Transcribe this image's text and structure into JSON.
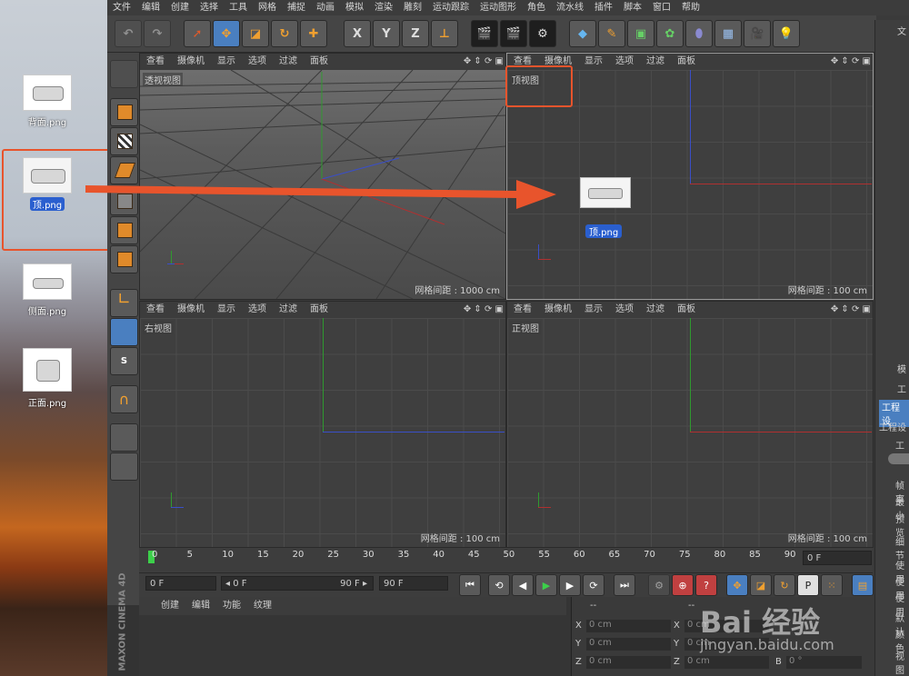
{
  "desktop": {
    "icons": [
      {
        "label": "背面.png",
        "selected": false
      },
      {
        "label": "顶.png",
        "selected": true
      },
      {
        "label": "侧面.png",
        "selected": false
      },
      {
        "label": "正面.png",
        "selected": false
      }
    ]
  },
  "menubar": [
    "文件",
    "编辑",
    "创建",
    "选择",
    "工具",
    "网格",
    "捕捉",
    "动画",
    "模拟",
    "渲染",
    "雕刻",
    "运动跟踪",
    "运动图形",
    "角色",
    "流水线",
    "插件",
    "脚本",
    "窗口",
    "帮助"
  ],
  "toolbar": {
    "axes": [
      "X",
      "Y",
      "Z"
    ]
  },
  "viewport_menu": [
    "查看",
    "摄像机",
    "显示",
    "选项",
    "过滤",
    "面板"
  ],
  "viewports": {
    "persp": {
      "name": "透视视图",
      "grid": "网格间距 : 1000 cm"
    },
    "top": {
      "name": "顶视图",
      "grid": "网格间距 : 100 cm"
    },
    "right": {
      "name": "右视图",
      "grid": "网格间距 : 100 cm"
    },
    "front": {
      "name": "正视图",
      "grid": "网格间距 : 100 cm"
    }
  },
  "drag_label": "顶.png",
  "timeline": {
    "ticks": [
      "0",
      "5",
      "10",
      "15",
      "20",
      "25",
      "30",
      "35",
      "40",
      "45",
      "50",
      "55",
      "60",
      "65",
      "70",
      "75",
      "80",
      "85",
      "90"
    ],
    "current_frame": "0 F"
  },
  "transport": {
    "start": "0 F",
    "range_start": "◂ 0 F",
    "range_end": "90 F ▸",
    "end": "90 F"
  },
  "bottom_menu": [
    "创建",
    "编辑",
    "功能",
    "纹理"
  ],
  "coords": {
    "rows": [
      {
        "axis": "X",
        "val": "0 cm",
        "axis2": "X",
        "val2": "0 cm"
      },
      {
        "axis": "Y",
        "val": "0 cm",
        "axis2": "Y",
        "val2": "0 cm"
      },
      {
        "axis": "Z",
        "val": "0 cm",
        "axis2": "Z",
        "val2": "0 cm"
      }
    ],
    "header": "--",
    "b_label": "B",
    "b_val": "0 °"
  },
  "right_panel": [
    "文",
    "模",
    "工",
    "工程设",
    "工程设",
    "工程",
    "帧率",
    "最小",
    "预览",
    "细节",
    "使用",
    "使用",
    "使用",
    "默认",
    "颜色",
    "视图"
  ],
  "brand": "MAXON CINEMA 4D",
  "watermark": "Bai 经验",
  "watermark_url": "jingyan.baidu.com",
  "colors": {
    "accent_red": "#e8542c",
    "axis_x": "#b03030",
    "axis_y": "#2f9a2f",
    "axis_z": "#3a4fc8",
    "selection_blue": "#2a5fcf"
  }
}
